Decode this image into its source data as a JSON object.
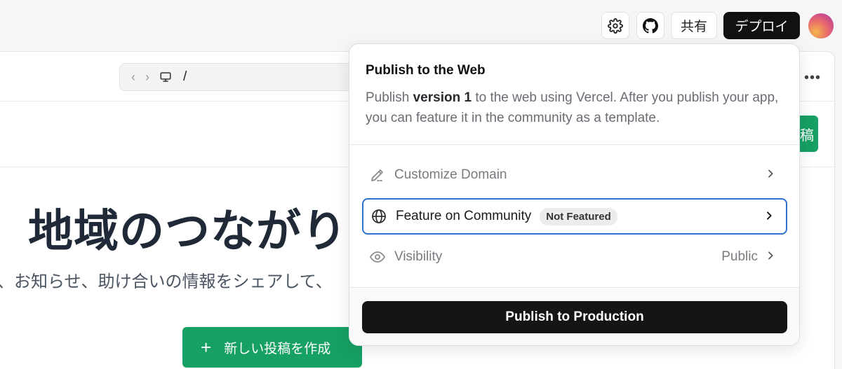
{
  "topbar": {
    "settings_icon": "gear-icon",
    "github_icon": "github-icon",
    "share_label": "共有",
    "deploy_label": "デプロイ"
  },
  "preview": {
    "url_path": "/",
    "post_button_partial": "稿",
    "hero_title": "地域のつながり",
    "hero_subtitle": "、お知らせ、助け合いの情報をシェアして、",
    "new_post_label": "新しい投稿を作成",
    "accent_color": "#16a064"
  },
  "popover": {
    "title": "Publish to the Web",
    "desc_prefix": "Publish ",
    "desc_version": "version 1",
    "desc_suffix": " to the web using Vercel. After you publish your app, you can feature it in the community as a template.",
    "rows": [
      {
        "label": "Customize Domain",
        "icon": "pencil-icon"
      },
      {
        "label": "Feature on Community",
        "icon": "globe-icon",
        "badge": "Not Featured"
      },
      {
        "label": "Visibility",
        "icon": "eye-icon",
        "value": "Public"
      }
    ],
    "publish_label": "Publish to Production"
  }
}
